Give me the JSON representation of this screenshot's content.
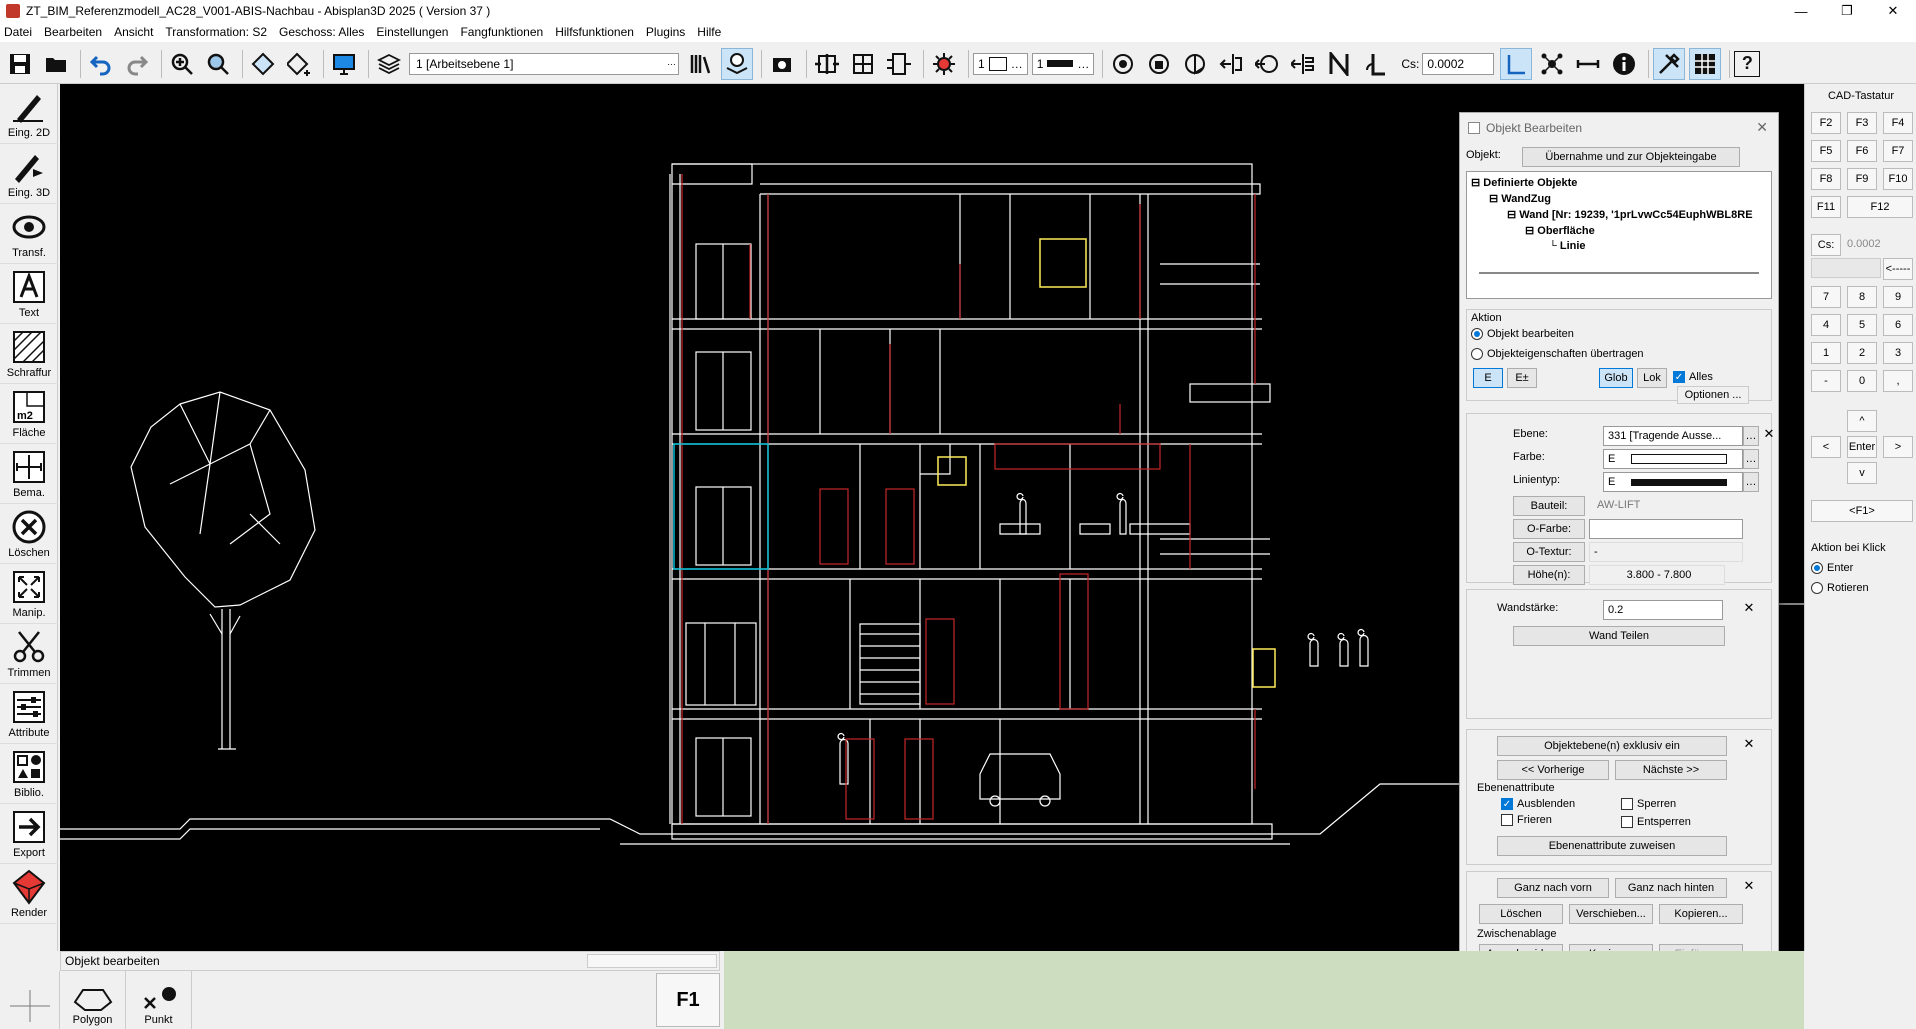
{
  "window": {
    "title": "ZT_BIM_Referenzmodell_AC28_V001-ABIS-Nachbau - Abisplan3D 2025 ( Version 37 )",
    "minimize": "—",
    "maximize": "❐",
    "close": "✕"
  },
  "menu": [
    "Datei",
    "Bearbeiten",
    "Ansicht",
    "Transformation: S2",
    "Geschoss: Alles",
    "Einstellungen",
    "Fangfunktionen",
    "Hilfsfunktionen",
    "Plugins",
    "Hilfe"
  ],
  "toolbar": {
    "layer_value": "1 [Arbeitsebene 1]",
    "pen1": "1",
    "pen2": "1",
    "cs_label": "Cs:",
    "cs_value": "0.0002",
    "help": "?"
  },
  "left_tools": [
    "Eing. 2D",
    "Eing. 3D",
    "Transf.",
    "Text",
    "Schraffur",
    "Fläche",
    "Bema.",
    "Löschen",
    "Manip.",
    "Trimmen",
    "Attribute",
    "Biblio.",
    "Export",
    "Render"
  ],
  "status": {
    "text": "Objekt bearbeiten",
    "f1": "F1"
  },
  "bottom_tools": [
    "Polygon",
    "Punkt"
  ],
  "dialog": {
    "title": "Objekt Bearbeiten",
    "objekt_label": "Objekt:",
    "uebernahme": "Übernahme und zur Objekteingabe",
    "tree": [
      "Definierte Objekte",
      "WandZug",
      "Wand [Nr: 19239, '1prLvwCc54EuphWBL8RE",
      "Oberfläche",
      "Linie"
    ],
    "aktion_label": "Aktion",
    "radio1": "Objekt bearbeiten",
    "radio2": "Objekteigenschaften übertragen",
    "btn_e": "E",
    "btn_epm": "E±",
    "btn_glob": "Glob",
    "btn_lok": "Lok",
    "alles": "Alles",
    "optionen": "Optionen ...",
    "ebene_label": "Ebene:",
    "ebene_value": "331 [Tragende Ausse...",
    "farbe_label": "Farbe:",
    "farbe_value": "E",
    "linientyp_label": "Linientyp:",
    "linientyp_value": "E",
    "bauteil_btn": "Bauteil:",
    "bauteil_value": "AW-LIFT",
    "ofarbe_btn": "O-Farbe:",
    "otextur_btn": "O-Textur:",
    "otextur_value": "-",
    "hoehe_btn": "Höhe(n):",
    "hoehe_value": "3.800  -  7.800",
    "wandstaerke_label": "Wandstärke:",
    "wandstaerke_value": "0.2",
    "wand_teilen": "Wand Teilen",
    "exklusiv": "Objektebene(n) exklusiv ein",
    "vorherige": "<< Vorherige",
    "naechste": "Nächste >>",
    "ebenenattribute": "Ebenenattribute",
    "ausblenden": "Ausblenden",
    "sperren": "Sperren",
    "frieren": "Frieren",
    "entsperren": "Entsperren",
    "zuweisen": "Ebenenattribute zuweisen",
    "ganz_vorn": "Ganz nach vorn",
    "ganz_hinten": "Ganz nach hinten",
    "loeschen": "Löschen",
    "verschieben": "Verschieben...",
    "kopieren_dots": "Kopieren...",
    "zwischenablage": "Zwischenablage",
    "ausschneiden": "Ausschneiden",
    "kopieren": "Kopieren",
    "einfuegen": "Einfügen..."
  },
  "cad": {
    "title": "CAD-Tastatur",
    "fkeys": [
      "F2",
      "F3",
      "F4",
      "F5",
      "F6",
      "F7",
      "F8",
      "F9",
      "F10",
      "F11",
      "F12"
    ],
    "cs_label": "Cs:",
    "cs_value": "0.0002",
    "back": "<-----",
    "digits": [
      "7",
      "8",
      "9",
      "4",
      "5",
      "6",
      "1",
      "2",
      "3",
      "-",
      "0",
      ","
    ],
    "up": "^",
    "left": "<",
    "enter": "Enter",
    "right": ">",
    "down": "v",
    "f1": "<F1>",
    "aktion_label": "Aktion bei Klick",
    "enter_opt": "Enter",
    "rotieren_opt": "Rotieren"
  }
}
